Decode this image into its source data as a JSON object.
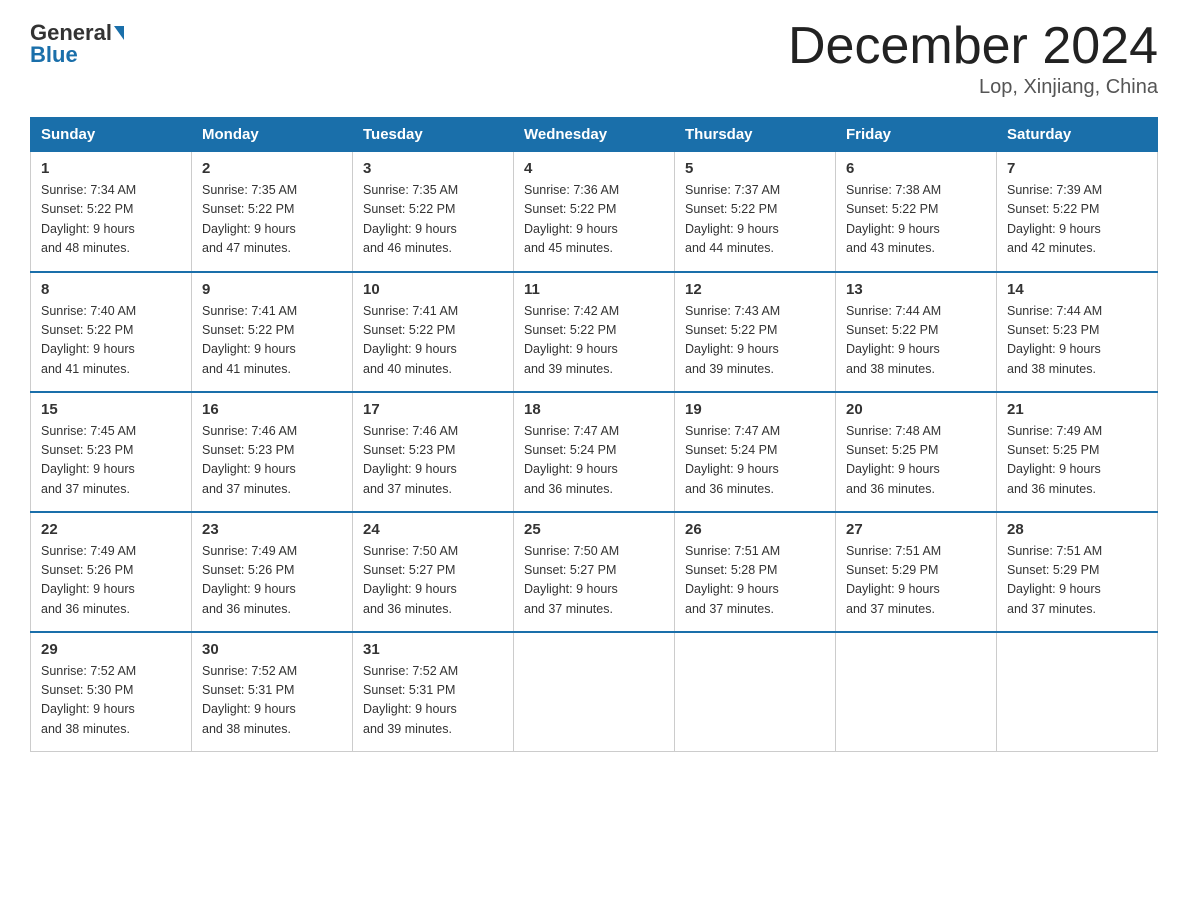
{
  "header": {
    "logo_general": "General",
    "logo_blue": "Blue",
    "month_title": "December 2024",
    "location": "Lop, Xinjiang, China"
  },
  "days_of_week": [
    "Sunday",
    "Monday",
    "Tuesday",
    "Wednesday",
    "Thursday",
    "Friday",
    "Saturday"
  ],
  "weeks": [
    [
      {
        "num": "1",
        "sunrise": "7:34 AM",
        "sunset": "5:22 PM",
        "daylight": "9 hours and 48 minutes."
      },
      {
        "num": "2",
        "sunrise": "7:35 AM",
        "sunset": "5:22 PM",
        "daylight": "9 hours and 47 minutes."
      },
      {
        "num": "3",
        "sunrise": "7:35 AM",
        "sunset": "5:22 PM",
        "daylight": "9 hours and 46 minutes."
      },
      {
        "num": "4",
        "sunrise": "7:36 AM",
        "sunset": "5:22 PM",
        "daylight": "9 hours and 45 minutes."
      },
      {
        "num": "5",
        "sunrise": "7:37 AM",
        "sunset": "5:22 PM",
        "daylight": "9 hours and 44 minutes."
      },
      {
        "num": "6",
        "sunrise": "7:38 AM",
        "sunset": "5:22 PM",
        "daylight": "9 hours and 43 minutes."
      },
      {
        "num": "7",
        "sunrise": "7:39 AM",
        "sunset": "5:22 PM",
        "daylight": "9 hours and 42 minutes."
      }
    ],
    [
      {
        "num": "8",
        "sunrise": "7:40 AM",
        "sunset": "5:22 PM",
        "daylight": "9 hours and 41 minutes."
      },
      {
        "num": "9",
        "sunrise": "7:41 AM",
        "sunset": "5:22 PM",
        "daylight": "9 hours and 41 minutes."
      },
      {
        "num": "10",
        "sunrise": "7:41 AM",
        "sunset": "5:22 PM",
        "daylight": "9 hours and 40 minutes."
      },
      {
        "num": "11",
        "sunrise": "7:42 AM",
        "sunset": "5:22 PM",
        "daylight": "9 hours and 39 minutes."
      },
      {
        "num": "12",
        "sunrise": "7:43 AM",
        "sunset": "5:22 PM",
        "daylight": "9 hours and 39 minutes."
      },
      {
        "num": "13",
        "sunrise": "7:44 AM",
        "sunset": "5:22 PM",
        "daylight": "9 hours and 38 minutes."
      },
      {
        "num": "14",
        "sunrise": "7:44 AM",
        "sunset": "5:23 PM",
        "daylight": "9 hours and 38 minutes."
      }
    ],
    [
      {
        "num": "15",
        "sunrise": "7:45 AM",
        "sunset": "5:23 PM",
        "daylight": "9 hours and 37 minutes."
      },
      {
        "num": "16",
        "sunrise": "7:46 AM",
        "sunset": "5:23 PM",
        "daylight": "9 hours and 37 minutes."
      },
      {
        "num": "17",
        "sunrise": "7:46 AM",
        "sunset": "5:23 PM",
        "daylight": "9 hours and 37 minutes."
      },
      {
        "num": "18",
        "sunrise": "7:47 AM",
        "sunset": "5:24 PM",
        "daylight": "9 hours and 36 minutes."
      },
      {
        "num": "19",
        "sunrise": "7:47 AM",
        "sunset": "5:24 PM",
        "daylight": "9 hours and 36 minutes."
      },
      {
        "num": "20",
        "sunrise": "7:48 AM",
        "sunset": "5:25 PM",
        "daylight": "9 hours and 36 minutes."
      },
      {
        "num": "21",
        "sunrise": "7:49 AM",
        "sunset": "5:25 PM",
        "daylight": "9 hours and 36 minutes."
      }
    ],
    [
      {
        "num": "22",
        "sunrise": "7:49 AM",
        "sunset": "5:26 PM",
        "daylight": "9 hours and 36 minutes."
      },
      {
        "num": "23",
        "sunrise": "7:49 AM",
        "sunset": "5:26 PM",
        "daylight": "9 hours and 36 minutes."
      },
      {
        "num": "24",
        "sunrise": "7:50 AM",
        "sunset": "5:27 PM",
        "daylight": "9 hours and 36 minutes."
      },
      {
        "num": "25",
        "sunrise": "7:50 AM",
        "sunset": "5:27 PM",
        "daylight": "9 hours and 37 minutes."
      },
      {
        "num": "26",
        "sunrise": "7:51 AM",
        "sunset": "5:28 PM",
        "daylight": "9 hours and 37 minutes."
      },
      {
        "num": "27",
        "sunrise": "7:51 AM",
        "sunset": "5:29 PM",
        "daylight": "9 hours and 37 minutes."
      },
      {
        "num": "28",
        "sunrise": "7:51 AM",
        "sunset": "5:29 PM",
        "daylight": "9 hours and 37 minutes."
      }
    ],
    [
      {
        "num": "29",
        "sunrise": "7:52 AM",
        "sunset": "5:30 PM",
        "daylight": "9 hours and 38 minutes."
      },
      {
        "num": "30",
        "sunrise": "7:52 AM",
        "sunset": "5:31 PM",
        "daylight": "9 hours and 38 minutes."
      },
      {
        "num": "31",
        "sunrise": "7:52 AM",
        "sunset": "5:31 PM",
        "daylight": "9 hours and 39 minutes."
      },
      null,
      null,
      null,
      null
    ]
  ],
  "labels": {
    "sunrise": "Sunrise:",
    "sunset": "Sunset:",
    "daylight": "Daylight:"
  }
}
